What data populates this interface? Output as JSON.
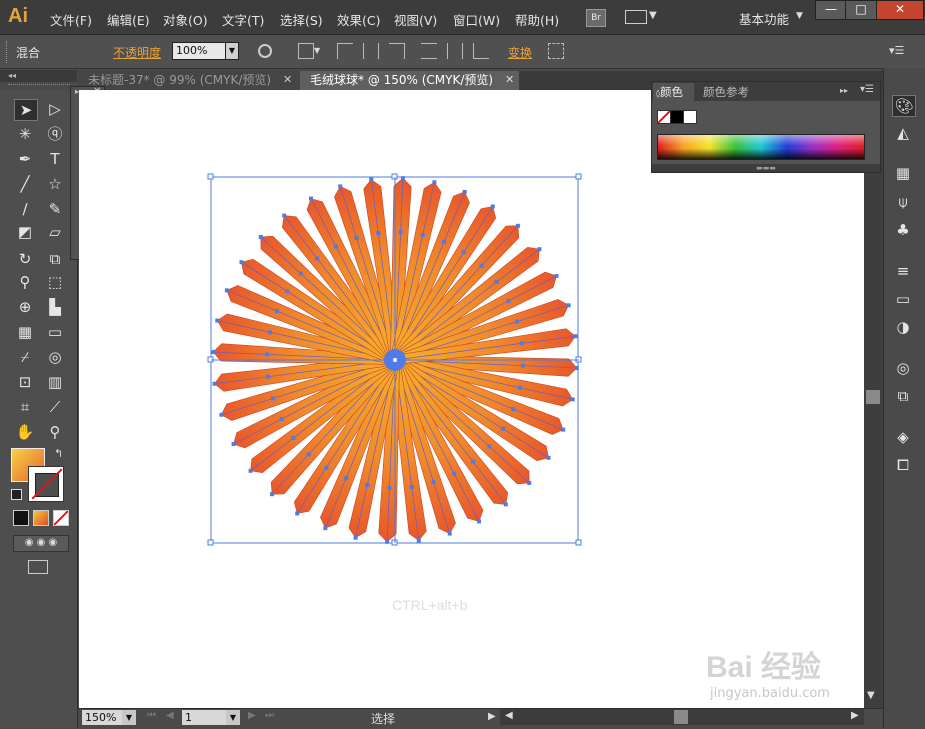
{
  "app": {
    "logo": "Ai",
    "menu": [
      "文件(F)",
      "编辑(E)",
      "对象(O)",
      "文字(T)",
      "选择(S)",
      "效果(C)",
      "视图(V)",
      "窗口(W)",
      "帮助(H)"
    ],
    "bridge_label": "Br",
    "workspace_label": "基本功能",
    "window_buttons": [
      "—",
      "□",
      "✕"
    ]
  },
  "control_bar": {
    "blend_label": "混合",
    "opacity_label": "不透明度",
    "opacity_value": "100%",
    "transform_label": "变换"
  },
  "tabs": [
    {
      "label": "未标题-37* @ 99% (CMYK/预览)",
      "active": false
    },
    {
      "label": "毛绒球球* @ 150% (CMYK/预览)",
      "active": true
    }
  ],
  "color_panel": {
    "tab_color": "颜色",
    "tab_guide": "颜色参考"
  },
  "canvas": {
    "annotation": "CTRL+alt+b",
    "annotation_color": "#e53030",
    "starburst_spokes": 36,
    "fill_outer": "#e8552a",
    "fill_inner": "#f4a52a"
  },
  "status": {
    "zoom": "150%",
    "page": "1",
    "tool_mode": "选择"
  },
  "watermark": {
    "brand": "Bai 经验",
    "url": "jingyan.baidu.com"
  }
}
